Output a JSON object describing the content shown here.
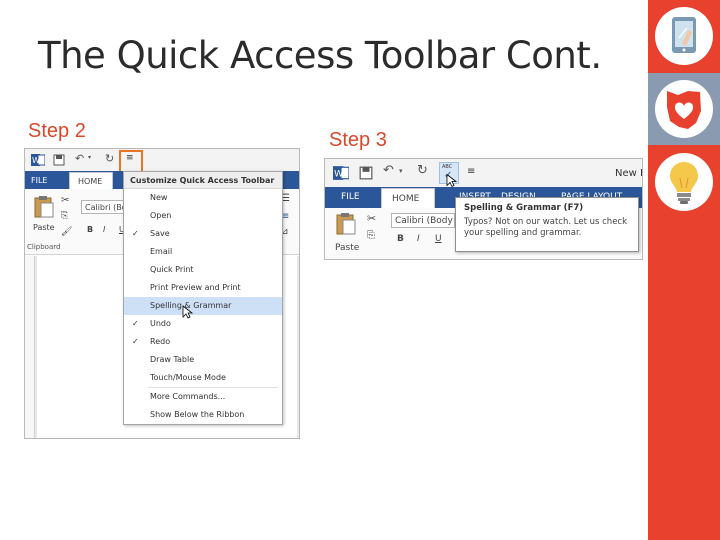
{
  "slide": {
    "title": "The Quick Access Toolbar Cont.",
    "title_color": "#2b2b2b",
    "step2_label": "Step 2",
    "step3_label": "Step 3",
    "step_label_color": "#d9482c"
  },
  "sidebar": {
    "accent": "#e8422f",
    "tiles": [
      {
        "icon": "tablet-touch-icon",
        "color": "#e8422f"
      },
      {
        "icon": "ohio-heart-icon",
        "color": "#8a9bb1"
      },
      {
        "icon": "lightbulb-icon",
        "color": "#e8422f"
      }
    ]
  },
  "step2_screenshot": {
    "tabs": {
      "file": "FILE",
      "home": "HOME"
    },
    "font_box": "Calibri (Bo",
    "paste_label": "Paste",
    "clipboard_label": "Clipboard",
    "format_buttons": [
      "B",
      "I",
      "U"
    ],
    "menu": {
      "header": "Customize Quick Access Toolbar",
      "items": [
        {
          "label": "New",
          "checked": false,
          "highlighted": false
        },
        {
          "label": "Open",
          "checked": false,
          "highlighted": false
        },
        {
          "label": "Save",
          "checked": true,
          "highlighted": false
        },
        {
          "label": "Email",
          "checked": false,
          "highlighted": false
        },
        {
          "label": "Quick Print",
          "checked": false,
          "highlighted": false
        },
        {
          "label": "Print Preview and Print",
          "checked": false,
          "highlighted": false
        },
        {
          "label": "Spelling & Grammar",
          "checked": false,
          "highlighted": true
        },
        {
          "label": "Undo",
          "checked": true,
          "highlighted": false
        },
        {
          "label": "Redo",
          "checked": true,
          "highlighted": false
        },
        {
          "label": "Draw Table",
          "checked": false,
          "highlighted": false
        },
        {
          "label": "Touch/Mouse Mode",
          "checked": false,
          "highlighted": false
        }
      ],
      "footer_items": [
        {
          "label": "More Commands..."
        },
        {
          "label": "Show Below the Ribbon"
        }
      ],
      "check_mark": "✓"
    },
    "highlight_color": "#e87625"
  },
  "step3_screenshot": {
    "tabs": {
      "file": "FILE",
      "home": "HOME",
      "insert": "INSERT",
      "design": "DESIGN",
      "page_layout": "PAGE LAYOUT"
    },
    "doc_title": "New D",
    "font_box": "Calibri (Body",
    "paste_label": "Paste",
    "format_buttons": [
      "B",
      "I",
      "U"
    ],
    "abc_label": "ABC",
    "tooltip": {
      "title": "Spelling & Grammar (F7)",
      "description": "Typos? Not on our watch. Let us check your spelling and grammar."
    }
  },
  "ribbon_color": "#2b579a"
}
